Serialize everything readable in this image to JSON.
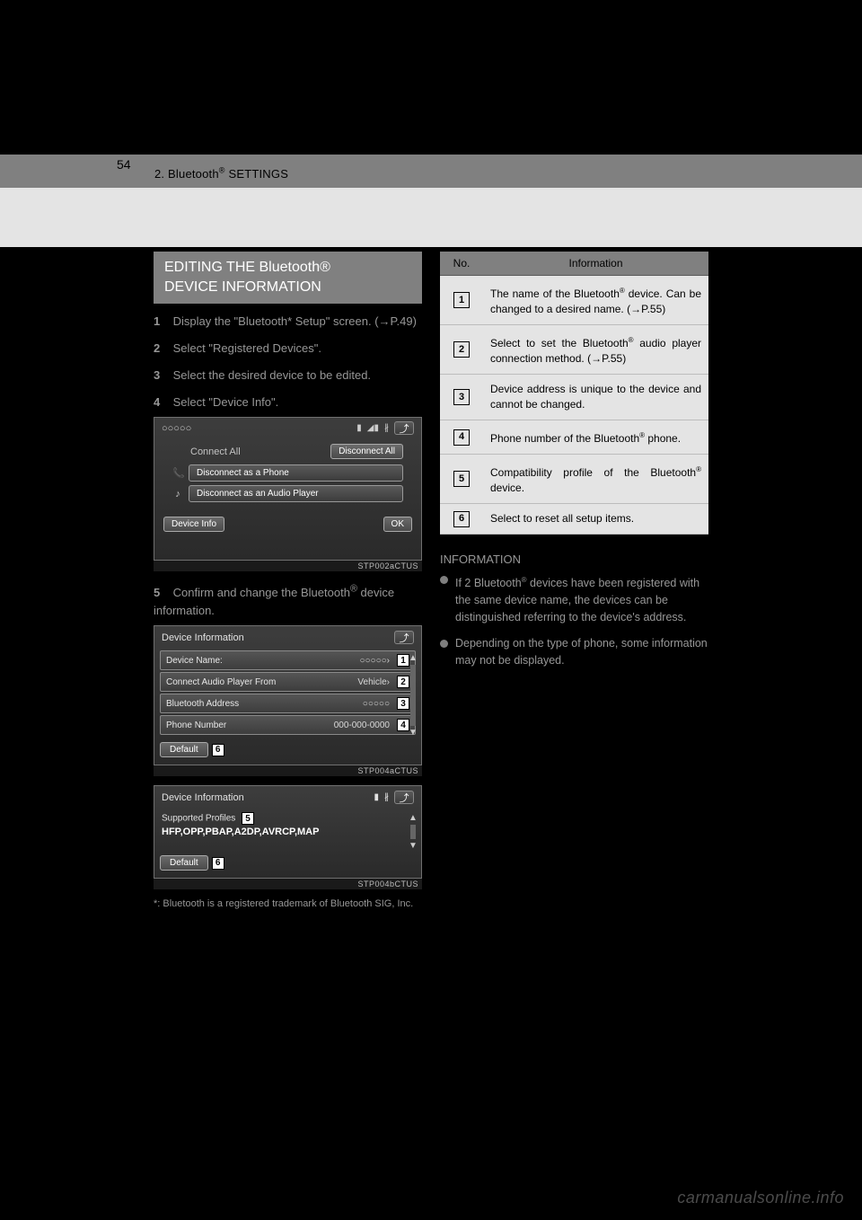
{
  "page": {
    "number": "54",
    "header": "2. Bluetooth® SETTINGS",
    "watermark": "carmanualsonline.info"
  },
  "section_title_line1": "EDITING THE Bluetooth®",
  "section_title_line2": "DEVICE INFORMATION",
  "steps": {
    "s1_num": "1",
    "s1_text": "Display the \"Bluetooth* Setup\" screen. (→P.49)",
    "s2_num": "2",
    "s2_text": "Select \"Registered Devices\".",
    "s3_num": "3",
    "s3_text": "Select the desired device to be edited.",
    "s4_num": "4",
    "s4_text": "Select \"Device Info\".",
    "s5_num": "5",
    "s5_text": "Confirm and change the Bluetooth® device information."
  },
  "footnote": "*: Bluetooth is a registered trademark of Bluetooth SIG, Inc.",
  "shot1": {
    "title": "○○○○○",
    "connect_all": "Connect All",
    "disconnect_all": "Disconnect All",
    "disconnect_phone": "Disconnect as a Phone",
    "disconnect_audio": "Disconnect as an Audio Player",
    "device_info": "Device Info",
    "ok": "OK",
    "caption": "STP002aCTUS"
  },
  "shot2": {
    "header": "Device Information",
    "rows": [
      {
        "label": "Device Name:",
        "value": "○○○○○",
        "callout": "1",
        "chev": "›"
      },
      {
        "label": "Connect Audio Player From",
        "value": "Vehicle",
        "callout": "2",
        "chev": "›"
      },
      {
        "label": "Bluetooth Address",
        "value": "○○○○○",
        "callout": "3",
        "chev": ""
      },
      {
        "label": "Phone Number",
        "value": "000-000-0000",
        "callout": "4",
        "chev": ""
      }
    ],
    "default": "Default",
    "default_callout": "6",
    "caption": "STP004aCTUS"
  },
  "shot3": {
    "header": "Device Information",
    "supported_label": "Supported Profiles",
    "supported_callout": "5",
    "profiles": "HFP,OPP,PBAP,A2DP,AVRCP,MAP",
    "default": "Default",
    "default_callout": "6",
    "caption": "STP004bCTUS"
  },
  "table": {
    "head_no": "No.",
    "head_info": "Information",
    "rows": [
      {
        "n": "1",
        "text": "The name of the Bluetooth® device. Can be changed to a desired name. (→P.55)"
      },
      {
        "n": "2",
        "text": "Select to set the Bluetooth® audio player connection method. (→P.55)"
      },
      {
        "n": "3",
        "text": "Device address is unique to the device and cannot be changed."
      },
      {
        "n": "4",
        "text": "Phone number of the Bluetooth® phone."
      },
      {
        "n": "5",
        "text": "Compatibility profile of the Bluetooth® device."
      },
      {
        "n": "6",
        "text": "Select to reset all setup items."
      }
    ]
  },
  "info_heading": "INFORMATION",
  "info_bullets": [
    "If 2 Bluetooth® devices have been registered with the same device name, the devices can be distinguished referring to the device's address.",
    "Depending on the type of phone, some information may not be displayed."
  ]
}
